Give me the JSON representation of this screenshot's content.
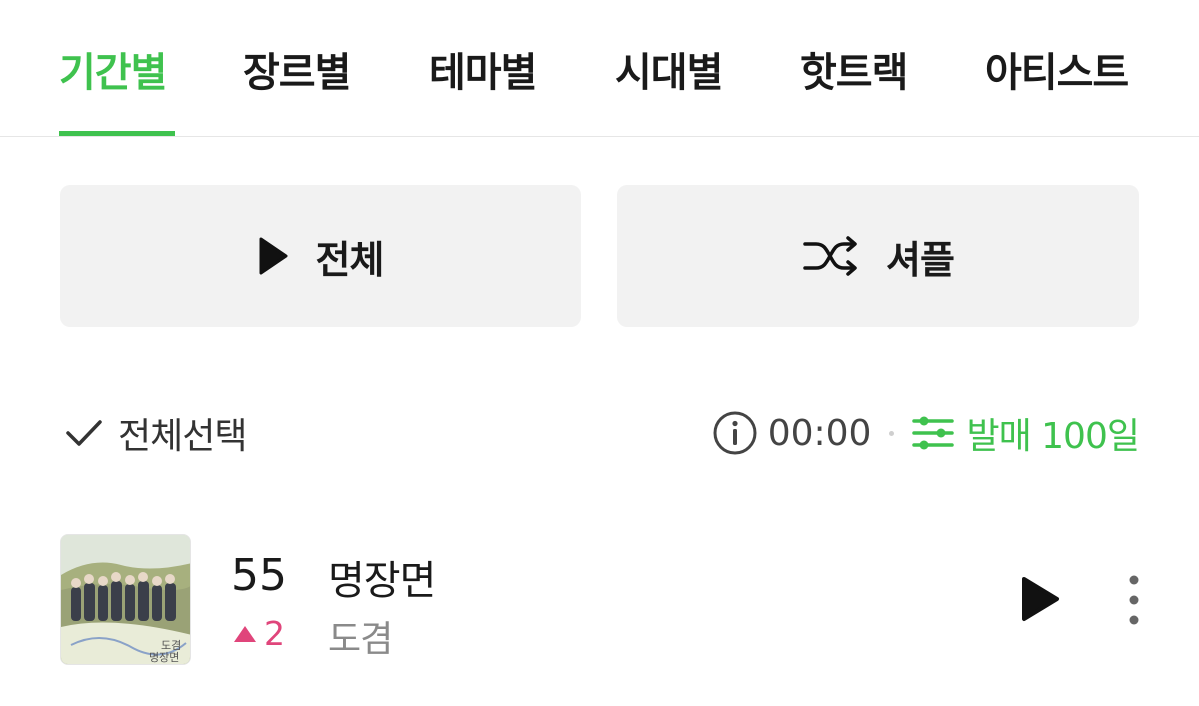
{
  "tabs": [
    {
      "label": "기간별",
      "active": true
    },
    {
      "label": "장르별",
      "active": false
    },
    {
      "label": "테마별",
      "active": false
    },
    {
      "label": "시대별",
      "active": false
    },
    {
      "label": "핫트랙",
      "active": false
    },
    {
      "label": "아티스트",
      "active": false
    }
  ],
  "actions": {
    "play_all_label": "전체",
    "shuffle_label": "셔플"
  },
  "toolbar": {
    "select_all_label": "전체선택",
    "duration": "00:00",
    "filter_label": "발매 100일"
  },
  "song": {
    "rank": "55",
    "rank_change": "2",
    "rank_direction": "up",
    "title": "명장면",
    "artist": "도겸",
    "album_art_text": "도겸 명장면"
  },
  "colors": {
    "accent": "#3fc24e",
    "rank_up": "#e0457b",
    "button_bg": "#f2f2f2"
  }
}
